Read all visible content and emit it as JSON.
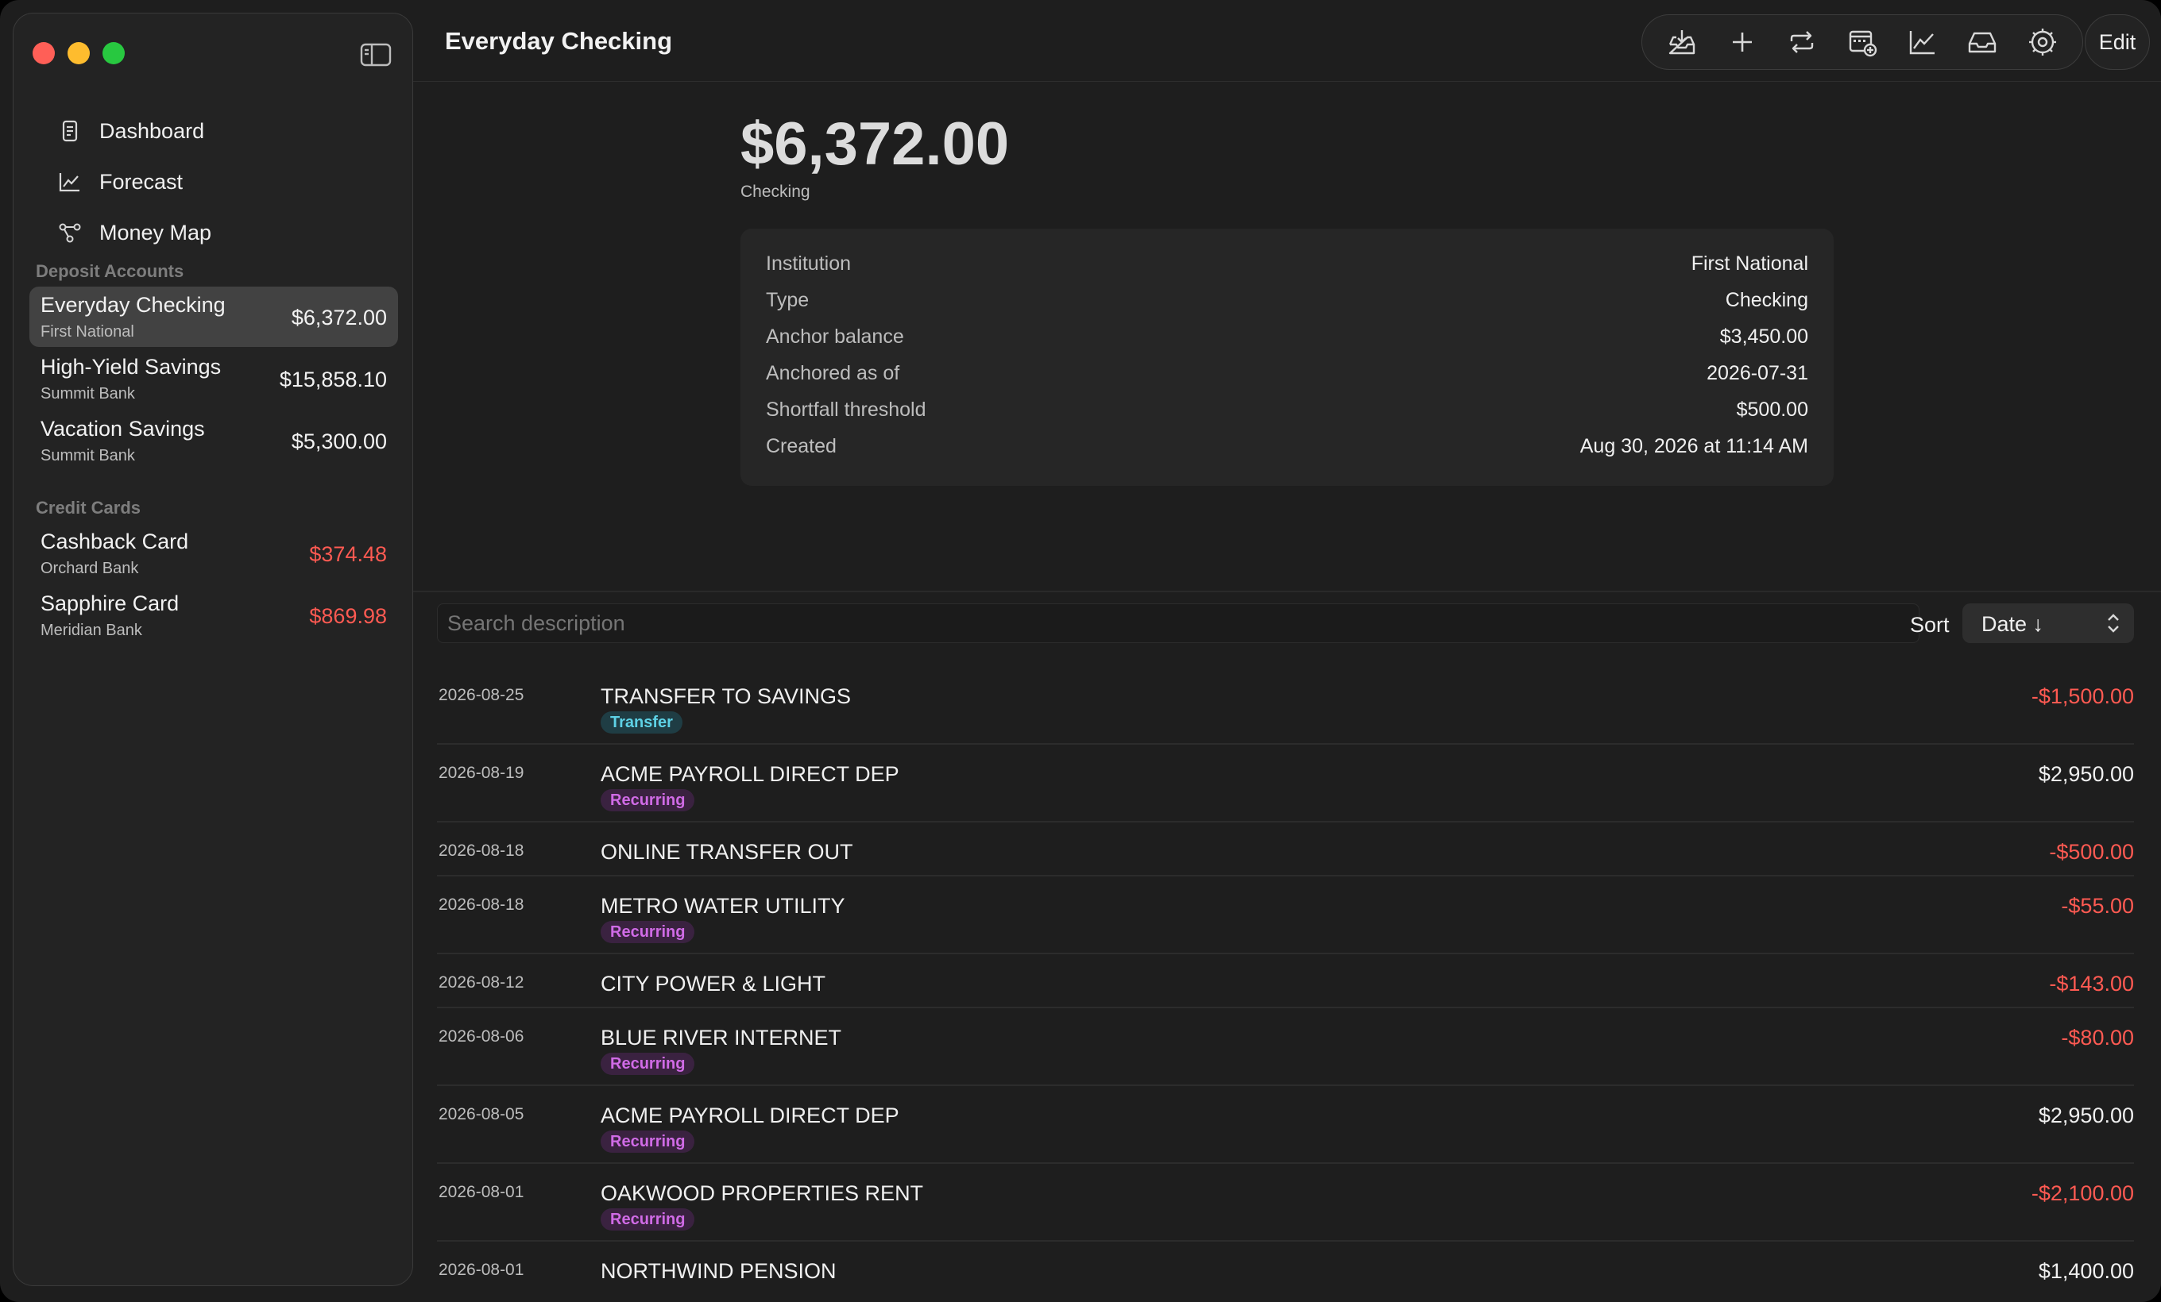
{
  "window": {
    "title": "Everyday Checking"
  },
  "sidebar": {
    "nav": [
      {
        "label": "Dashboard",
        "icon": "dashboard-icon"
      },
      {
        "label": "Forecast",
        "icon": "chart-line-icon"
      },
      {
        "label": "Money Map",
        "icon": "network-icon"
      }
    ],
    "deposit_title": "Deposit Accounts",
    "deposit_accounts": [
      {
        "name": "Everyday Checking",
        "institution": "First National",
        "balance": "$6,372.00",
        "selected": true
      },
      {
        "name": "High-Yield Savings",
        "institution": "Summit Bank",
        "balance": "$15,858.10"
      },
      {
        "name": "Vacation Savings",
        "institution": "Summit Bank",
        "balance": "$5,300.00"
      }
    ],
    "credit_title": "Credit Cards",
    "credit_cards": [
      {
        "name": "Cashback Card",
        "institution": "Orchard Bank",
        "balance": "$374.48"
      },
      {
        "name": "Sapphire Card",
        "institution": "Meridian Bank",
        "balance": "$869.98"
      }
    ]
  },
  "toolbar": {
    "icons": [
      "import-icon",
      "add-icon",
      "repeat-icon",
      "calendar-add-icon",
      "chart-icon",
      "inbox-icon",
      "settings-icon"
    ],
    "edit_label": "Edit"
  },
  "account": {
    "balance": "$6,372.00",
    "type_label": "Checking",
    "details": [
      {
        "label": "Institution",
        "value": "First National"
      },
      {
        "label": "Type",
        "value": "Checking"
      },
      {
        "label": "Anchor balance",
        "value": "$3,450.00"
      },
      {
        "label": "Anchored as of",
        "value": "2026-07-31"
      },
      {
        "label": "Shortfall threshold",
        "value": "$500.00"
      },
      {
        "label": "Created",
        "value": "Aug 30, 2026 at 11:14 AM"
      }
    ]
  },
  "search": {
    "placeholder": "Search description"
  },
  "sort": {
    "label": "Sort",
    "value": "Date ↓"
  },
  "transactions": [
    {
      "date": "2026-08-25",
      "description": "TRANSFER TO SAVINGS",
      "amount": "-$1,500.00",
      "tag": "Transfer"
    },
    {
      "date": "2026-08-19",
      "description": "ACME PAYROLL DIRECT DEP",
      "amount": "$2,950.00",
      "tag": "Recurring"
    },
    {
      "date": "2026-08-18",
      "description": "ONLINE TRANSFER OUT",
      "amount": "-$500.00",
      "tag": ""
    },
    {
      "date": "2026-08-18",
      "description": "METRO WATER UTILITY",
      "amount": "-$55.00",
      "tag": "Recurring"
    },
    {
      "date": "2026-08-12",
      "description": "CITY POWER & LIGHT",
      "amount": "-$143.00",
      "tag": ""
    },
    {
      "date": "2026-08-06",
      "description": "BLUE RIVER INTERNET",
      "amount": "-$80.00",
      "tag": "Recurring"
    },
    {
      "date": "2026-08-05",
      "description": "ACME PAYROLL DIRECT DEP",
      "amount": "$2,950.00",
      "tag": "Recurring"
    },
    {
      "date": "2026-08-01",
      "description": "OAKWOOD PROPERTIES RENT",
      "amount": "-$2,100.00",
      "tag": "Recurring"
    },
    {
      "date": "2026-08-01",
      "description": "NORTHWIND PENSION",
      "amount": "$1,400.00",
      "tag": ""
    }
  ],
  "colors": {
    "negative": "#ff5a52",
    "selected_row": "#424242",
    "transfer_tag": "#5ed2e6",
    "recurring_tag": "#d06be6"
  }
}
